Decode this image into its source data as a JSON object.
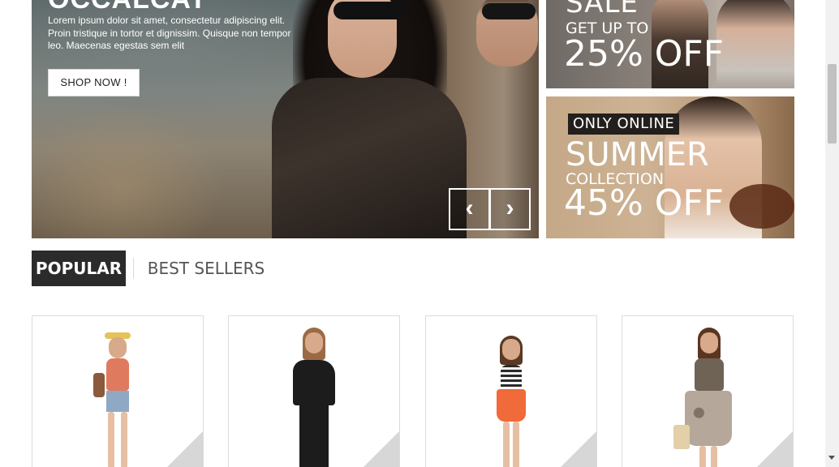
{
  "slider": {
    "title": "OCCALCAT",
    "text": "Lorem ipsum dolor sit amet, consectetur adipiscing elit. Proin tristique in tortor et dignissim. Quisque non tempor leo. Maecenas egestas sem elit",
    "button_label": "SHOP NOW !",
    "prev_icon": "chevron-left-icon",
    "next_icon": "chevron-right-icon",
    "prev_glyph": "‹",
    "next_glyph": "›"
  },
  "banners": {
    "top": {
      "headline": "SALE",
      "subline": "GET UP TO",
      "discount": "25% OFF"
    },
    "bottom": {
      "badge": "ONLY ONLINE",
      "headline": "SUMMER",
      "subline": "COLLECTION",
      "discount": "45% OFF"
    }
  },
  "tabs": [
    {
      "label": "POPULAR",
      "active": true
    },
    {
      "label": "BEST SELLERS",
      "active": false
    }
  ],
  "products": [
    {
      "icon": "quick-view-eye-icon",
      "top_color": "#e07a5f",
      "bottom_color": "#8fa9c4",
      "hair_color": "#8a5a3b"
    },
    {
      "icon": "quick-view-eye-icon",
      "top_color": "#1c1c1c",
      "bottom_color": "#1c1c1c",
      "hair_color": "#9a6a45"
    },
    {
      "icon": "quick-view-eye-icon",
      "top_color": "#2b2b2b",
      "bottom_color": "#f06a3a",
      "hair_color": "#5a3a25"
    },
    {
      "icon": "quick-view-eye-icon",
      "top_color": "#6f6356",
      "bottom_color": "#b5a89a",
      "hair_color": "#5a3520"
    }
  ],
  "colors": {
    "tab_active_bg": "#2b2b2b",
    "tab_inactive_text": "#555555",
    "card_border": "#dcdcdc"
  }
}
